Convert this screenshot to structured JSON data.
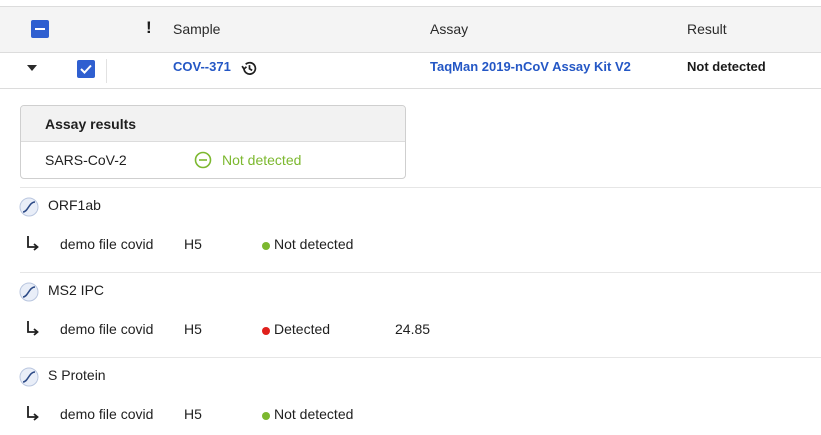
{
  "header": {
    "flag_glyph": "!",
    "columns": {
      "sample": "Sample",
      "assay": "Assay",
      "result": "Result"
    }
  },
  "row": {
    "sample": "COV--371",
    "assay": "TaqMan 2019-nCoV Assay Kit V2",
    "result": "Not detected"
  },
  "assay_results": {
    "title": "Assay results",
    "target": "SARS-CoV-2",
    "status": "Not detected",
    "status_color": "#7cb82f"
  },
  "targets": [
    {
      "name": "ORF1ab",
      "file": "demo file covid",
      "well": "H5",
      "status": "Not detected",
      "status_color": "#7cb82f",
      "ct": ""
    },
    {
      "name": "MS2 IPC",
      "file": "demo file covid",
      "well": "H5",
      "status": "Detected",
      "status_color": "#e0201c",
      "ct": "24.85"
    },
    {
      "name": "S Protein",
      "file": "demo file covid",
      "well": "H5",
      "status": "Not detected",
      "status_color": "#7cb82f",
      "ct": ""
    }
  ],
  "colors": {
    "accent": "#2f5fd0",
    "link": "#2457c5"
  },
  "icons": [
    "minus-checkbox-icon",
    "warning-flag-icon",
    "caret-down-icon",
    "checkbox-checked-icon",
    "history-icon",
    "not-detected-icon",
    "amplification-curve-icon",
    "sub-arrow-icon"
  ]
}
